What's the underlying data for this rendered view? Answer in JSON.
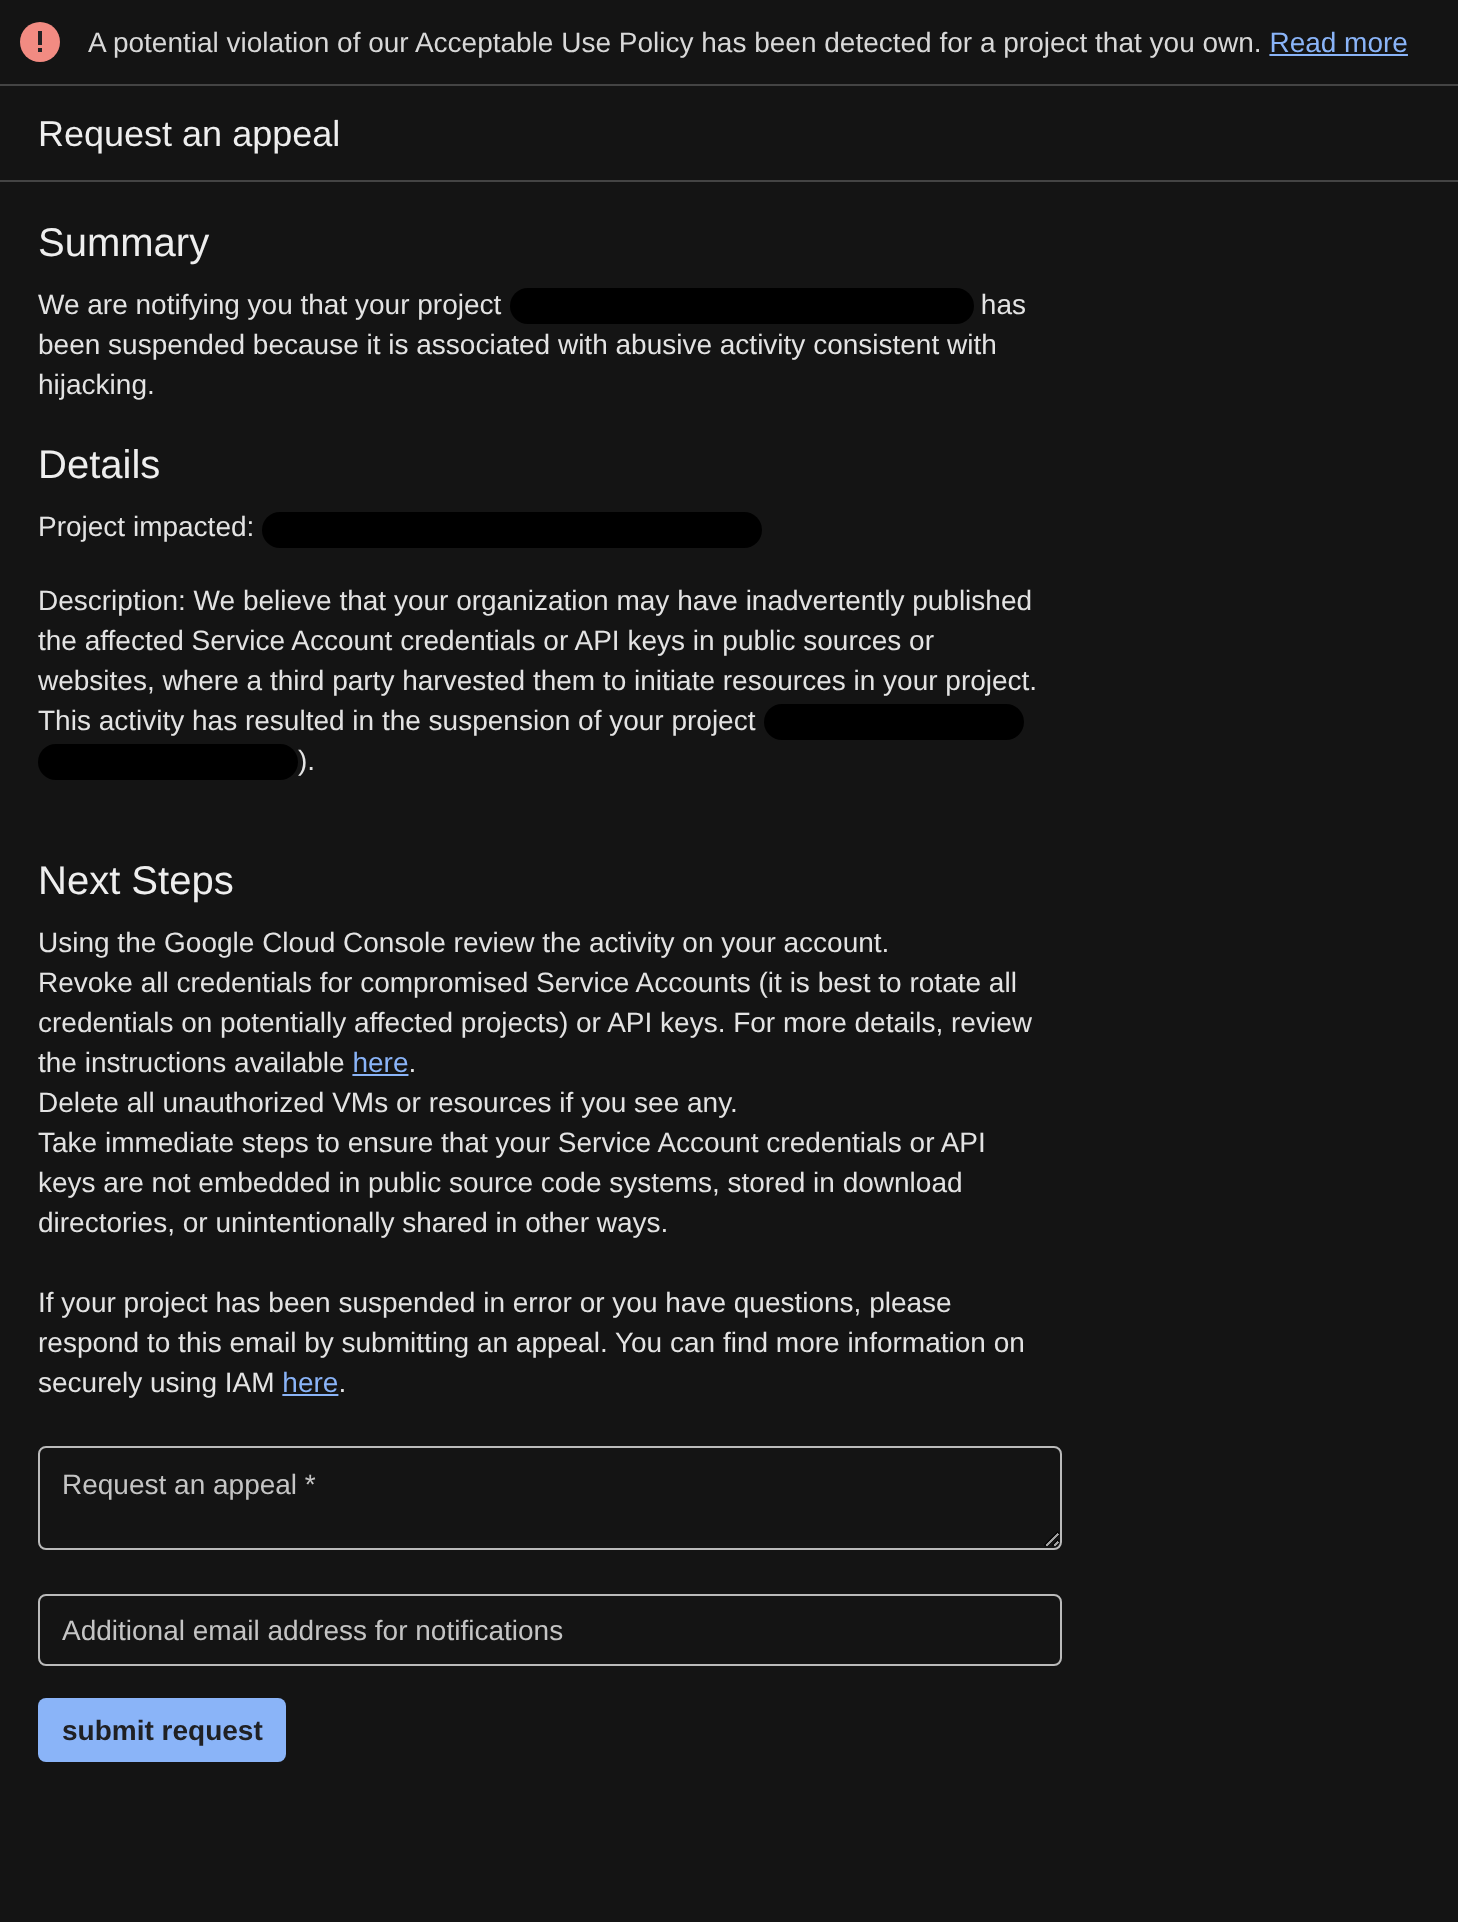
{
  "banner": {
    "message": "A potential violation of our Acceptable Use Policy has been detected for a project that you own.",
    "link": "Read more"
  },
  "page_title": "Request an appeal",
  "sections": [
    {
      "heading": "Summary",
      "paragraphs": [
        [
          {
            "kind": "text",
            "text": "We are notifying you that your project "
          },
          {
            "kind": "redaction"
          },
          {
            "kind": "text",
            "text": " has been suspended because it is associated with abusive activity consistent with hijacking."
          }
        ]
      ]
    },
    {
      "heading": "Details",
      "paragraphs": [
        [
          {
            "kind": "text",
            "text": "Project impacted: "
          },
          {
            "kind": "redaction"
          }
        ],
        [
          {
            "kind": "text",
            "text": "Description: We believe that your organization may have inadvertently published the affected Service Account credentials or API keys in public sources or websites, where a third party harvested them to initiate resources in your project. This activity has resulted in the suspension of your project "
          },
          {
            "kind": "redaction"
          },
          {
            "kind": "redaction"
          },
          {
            "kind": "text",
            "text": ")."
          }
        ]
      ]
    },
    {
      "heading": "Next Steps",
      "paragraphs": [
        [
          {
            "kind": "text",
            "text": "Using the Google Cloud Console review the activity on your account."
          }
        ],
        [
          {
            "kind": "text",
            "text": "Revoke all credentials for compromised Service Accounts (it is best to rotate all credentials on potentially affected projects) or API keys. For more details, review the instructions available "
          },
          {
            "kind": "link",
            "text": "here"
          },
          {
            "kind": "text",
            "text": "."
          }
        ],
        [
          {
            "kind": "text",
            "text": "Delete all unauthorized VMs or resources if you see any."
          }
        ],
        [
          {
            "kind": "text",
            "text": "Take immediate steps to ensure that your Service Account credentials or API keys are not embedded in public source code systems, stored in download directories, or unintentionally shared in other ways."
          }
        ],
        [
          {
            "kind": "gap"
          }
        ],
        [
          {
            "kind": "text",
            "text": "If your project has been suspended in error or you have questions, please respond to this email by submitting an appeal. You can find more information on securely using IAM "
          },
          {
            "kind": "link",
            "text": "here"
          },
          {
            "kind": "text",
            "text": "."
          }
        ]
      ]
    }
  ],
  "form": {
    "appeal_field": {
      "placeholder": "Request an appeal *"
    },
    "email_field": {
      "placeholder": "Additional email address for notifications"
    },
    "submit": "submit request"
  }
}
